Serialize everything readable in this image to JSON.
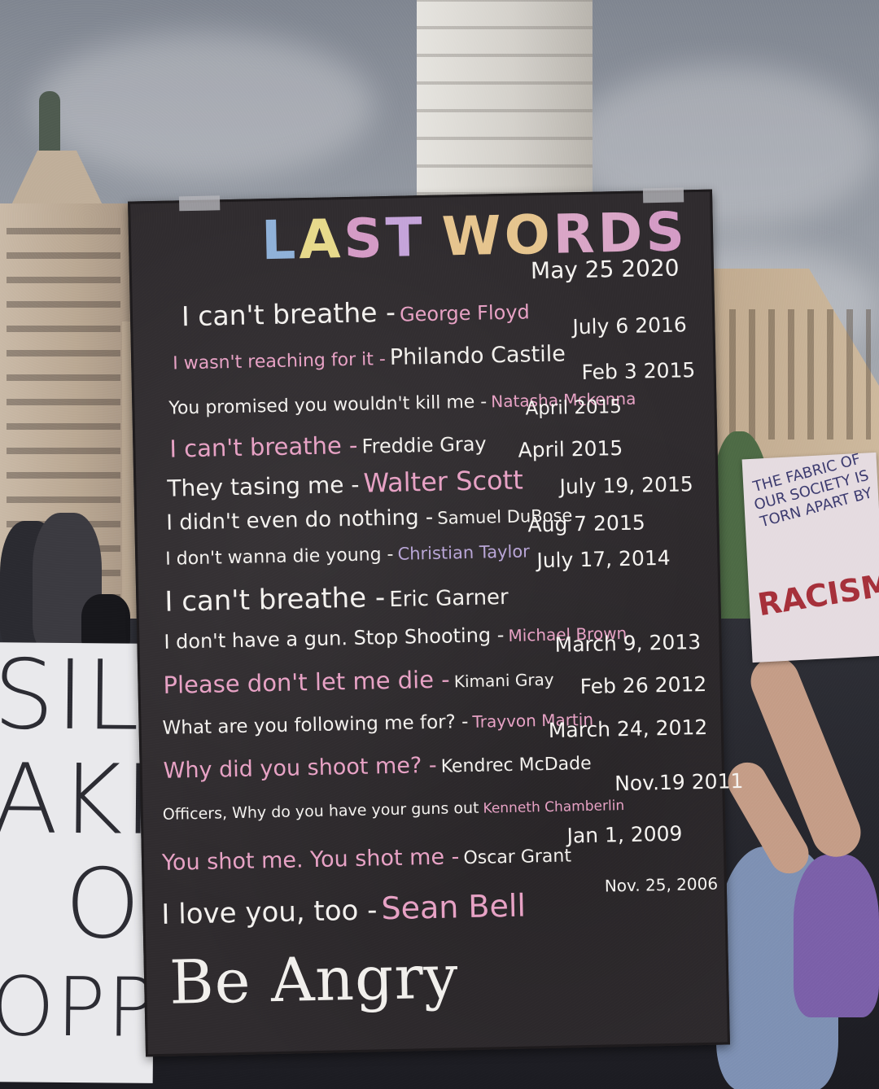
{
  "board": {
    "title_letters": [
      "L",
      "A",
      "S",
      "T",
      " ",
      "W",
      "O",
      "R",
      "D",
      "S"
    ],
    "title_colors": [
      "#8fb1d8",
      "#e7d98a",
      "#d49ac5",
      "#c4a3d9",
      " ",
      "#e6c48d",
      "#e6c48d",
      "#d9a5c6",
      "#d9a5c6",
      "#d49ac5"
    ],
    "entries": [
      {
        "quote": "I can't breathe -",
        "name": "George Floyd",
        "name_color": "#e7a1c4",
        "date": "May 25 2020"
      },
      {
        "quote": "I wasn't reaching for it -",
        "name": "Philando Castile",
        "name_color": "#f2f0ec",
        "date": "July 6 2016"
      },
      {
        "quote": "You promised you wouldn't kill me -",
        "name": "Natasha Mckenna",
        "name_color": "#e7a1c4",
        "date": "Feb 3 2015"
      },
      {
        "quote": "I can't breathe -",
        "name": "Freddie Gray",
        "name_color": "#f2f0ec",
        "date": "April 2015"
      },
      {
        "quote": "They tasing me -",
        "name": "Walter Scott",
        "name_color": "#e7a1c4",
        "date": "April 2015"
      },
      {
        "quote": "I didn't even do nothing -",
        "name": "Samuel DuBose",
        "name_color": "#f2f0ec",
        "date": "July 19, 2015"
      },
      {
        "quote": "I don't wanna die young -",
        "name": "Christian Taylor",
        "name_color": "#b8a5d6",
        "date": "Aug 7 2015"
      },
      {
        "quote": "I can't breathe -",
        "name": "Eric Garner",
        "name_color": "#f2f0ec",
        "date": "July 17, 2014"
      },
      {
        "quote": "I don't have a gun. Stop Shooting -",
        "name": "Michael Brown",
        "name_color": "#e7a1c4",
        "date": "March 9, 2013"
      },
      {
        "quote": "Please don't let me die -",
        "name": "Kimani Gray",
        "name_color": "#f2f0ec",
        "date": "Feb 26 2012"
      },
      {
        "quote": "What are you following me for? -",
        "name": "Trayvon Martin",
        "name_color": "#e7a1c4",
        "date": "March 24, 2012"
      },
      {
        "quote": "Why did you shoot me? -",
        "name": "Kendrec McDade",
        "name_color": "#f2f0ec",
        "date": "Nov.19 2011"
      },
      {
        "quote": "Officers, Why do you have your guns out",
        "name": "Kenneth Chamberlin",
        "name_color": "#e7a1c4",
        "date": "Jan 1, 2009"
      },
      {
        "quote": "You shot me. You shot me -",
        "name": "Oscar Grant",
        "name_color": "#f2f0ec",
        "date": "Nov. 25, 2006"
      },
      {
        "quote": "I love you, too -",
        "name": "Sean Bell",
        "name_color": "#e7a1c4",
        "date": ""
      }
    ],
    "closing": "Be Angry"
  },
  "left_sign": {
    "lines": [
      "SIL",
      "AKIN",
      "O",
      "OPPRE"
    ]
  },
  "right_sign": {
    "text": "THE FABRIC OF OUR SOCIETY IS TORN APART BY",
    "emphasis": "RACISM"
  }
}
